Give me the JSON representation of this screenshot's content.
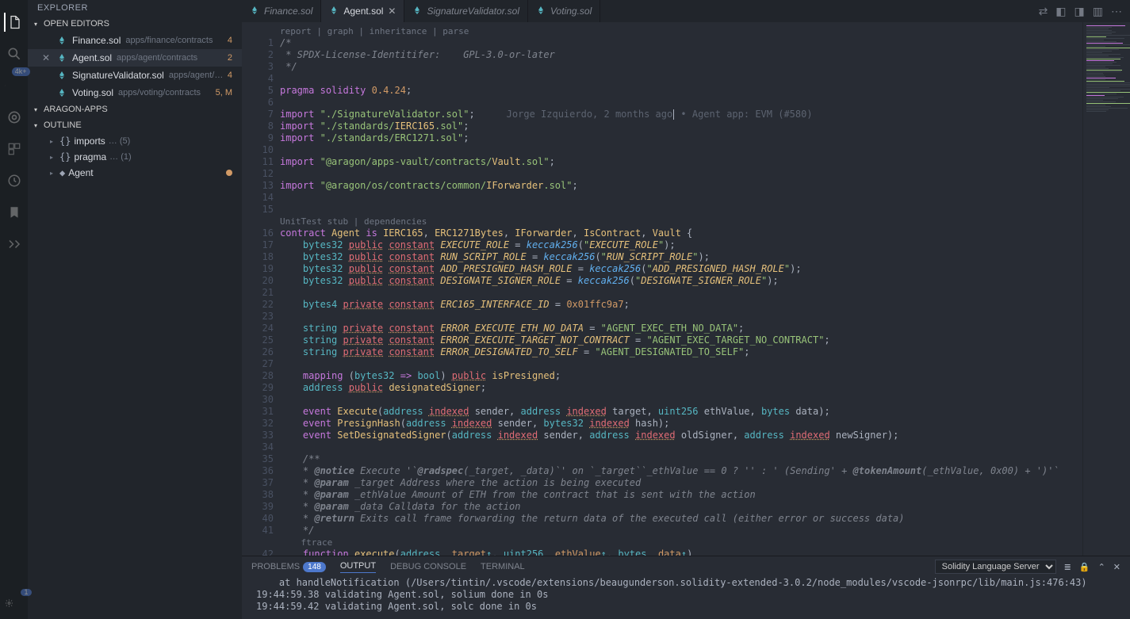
{
  "sidebar": {
    "title": "EXPLORER",
    "sections": {
      "openEditors": "OPEN EDITORS",
      "project": "ARAGON-APPS",
      "outline": "OUTLINE"
    },
    "editors": [
      {
        "name": "Finance.sol",
        "path": "apps/finance/contracts",
        "badge": "4"
      },
      {
        "name": "Agent.sol",
        "path": "apps/agent/contracts",
        "badge": "2",
        "active": true,
        "closable": true
      },
      {
        "name": "SignatureValidator.sol",
        "path": "apps/agent/cont…",
        "badge": "4"
      },
      {
        "name": "Voting.sol",
        "path": "apps/voting/contracts",
        "badge": "5, M"
      }
    ],
    "outline": [
      {
        "sym": "{}",
        "label": "imports",
        "suffix": "… (5)",
        "expandable": true
      },
      {
        "sym": "{}",
        "label": "pragma",
        "suffix": "… (1)",
        "expandable": true
      },
      {
        "sym": "◆",
        "label": "Agent",
        "mod": true,
        "expandable": true
      }
    ]
  },
  "activity_badge": "4k+",
  "tabs": [
    {
      "label": "Finance.sol"
    },
    {
      "label": "Agent.sol",
      "active": true
    },
    {
      "label": "SignatureValidator.sol",
      "italic": true
    },
    {
      "label": "Voting.sol"
    }
  ],
  "codelens1": "report | graph | inheritance | parse",
  "codelens2": "UnitTest stub | dependencies",
  "codelens3": "ftrace",
  "blame": "Jorge Izquierdo, 2 months ago • Agent app: EVM (#580)",
  "lines": [
    "/*",
    " * SPDX-License-Identitifer:    GPL-3.0-or-later",
    " */",
    "",
    "pragma solidity 0.4.24;",
    "",
    "import \"./SignatureValidator.sol\";",
    "import \"./standards/IERC165.sol\";",
    "import \"./standards/ERC1271.sol\";",
    "",
    "import \"@aragon/apps-vault/contracts/Vault.sol\";",
    "",
    "import \"@aragon/os/contracts/common/IForwarder.sol\";",
    "",
    "",
    "contract Agent is IERC165, ERC1271Bytes, IForwarder, IsContract, Vault {",
    "    bytes32 public constant EXECUTE_ROLE = keccak256(\"EXECUTE_ROLE\");",
    "    bytes32 public constant RUN_SCRIPT_ROLE = keccak256(\"RUN_SCRIPT_ROLE\");",
    "    bytes32 public constant ADD_PRESIGNED_HASH_ROLE = keccak256(\"ADD_PRESIGNED_HASH_ROLE\");",
    "    bytes32 public constant DESIGNATE_SIGNER_ROLE = keccak256(\"DESIGNATE_SIGNER_ROLE\");",
    "",
    "    bytes4 private constant ERC165_INTERFACE_ID = 0x01ffc9a7;",
    "",
    "    string private constant ERROR_EXECUTE_ETH_NO_DATA = \"AGENT_EXEC_ETH_NO_DATA\";",
    "    string private constant ERROR_EXECUTE_TARGET_NOT_CONTRACT = \"AGENT_EXEC_TARGET_NO_CONTRACT\";",
    "    string private constant ERROR_DESIGNATED_TO_SELF = \"AGENT_DESIGNATED_TO_SELF\";",
    "",
    "    mapping (bytes32 => bool) public isPresigned;",
    "    address public designatedSigner;",
    "",
    "    event Execute(address indexed sender, address indexed target, uint256 ethValue, bytes data);",
    "    event PresignHash(address indexed sender, bytes32 indexed hash);",
    "    event SetDesignatedSigner(address indexed sender, address indexed oldSigner, address indexed newSigner);",
    "",
    "    /**",
    "    * @notice Execute '`@radspec(_target, _data)`' on `_target``_ethValue == 0 ? '' : ' (Sending' + @tokenAmount(_ethValue, 0x00) + ')'`",
    "    * @param _target Address where the action is being executed",
    "    * @param _ethValue Amount of ETH from the contract that is sent with the action",
    "    * @param _data Calldata for the action",
    "    * @return Exits call frame forwarding the return data of the executed call (either error or success data)",
    "    */",
    "    function execute(address _target↑, uint256 _ethValue↑, bytes _data↑)"
  ],
  "panel": {
    "tabs": {
      "problems": "PROBLEMS",
      "problemsBadge": "148",
      "output": "OUTPUT",
      "debug": "DEBUG CONSOLE",
      "terminal": "TERMINAL"
    },
    "selector": "Solidity Language Server",
    "out": [
      "    at handleNotification (/Users/tintin/.vscode/extensions/beaugunderson.solidity-extended-3.0.2/node_modules/vscode-jsonrpc/lib/main.js:476:43)",
      "19:44:59.38 validating Agent.sol, solium done in 0s",
      "19:44:59.42 validating Agent.sol, solc done in 0s"
    ]
  }
}
